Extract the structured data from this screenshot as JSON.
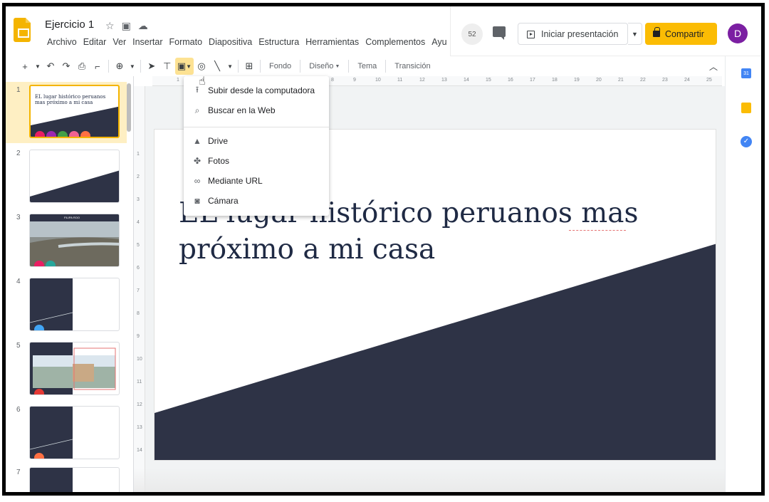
{
  "document": {
    "title": "Ejercicio 1"
  },
  "menubar": [
    "Archivo",
    "Editar",
    "Ver",
    "Insertar",
    "Formato",
    "Diapositiva",
    "Estructura",
    "Herramientas",
    "Complementos",
    "Ayu"
  ],
  "header": {
    "badge_count": "52",
    "present_label": "Iniciar presentación",
    "share_label": "Compartir",
    "avatar_initial": "D"
  },
  "toolbar": {
    "fondo": "Fondo",
    "diseno": "Diseño",
    "tema": "Tema",
    "transicion": "Transición"
  },
  "side_panel": {
    "calendar_day": "31"
  },
  "ruler": {
    "top": [
      "1",
      "2",
      "3",
      "4",
      "5",
      "6",
      "7",
      "8",
      "9",
      "10",
      "11",
      "12",
      "13",
      "14",
      "15",
      "16",
      "17",
      "18",
      "19",
      "20",
      "21",
      "22",
      "23",
      "24",
      "25"
    ],
    "left": [
      "1",
      "2",
      "3",
      "4",
      "5",
      "6",
      "7",
      "8",
      "9",
      "10",
      "11",
      "12",
      "13",
      "14"
    ]
  },
  "slides": [
    {
      "number": "1",
      "text": "EL lugar histórico peruanos mas próximo a mi casa"
    },
    {
      "number": "2"
    },
    {
      "number": "3",
      "caption": "FILIPA ROO"
    },
    {
      "number": "4"
    },
    {
      "number": "5"
    },
    {
      "number": "6"
    },
    {
      "number": "7"
    }
  ],
  "slide_main": {
    "title_line1": "EL lugar histórico peruanos mas",
    "title_line2": "próximo a mi casa"
  },
  "image_menu": {
    "items": [
      {
        "label": "Subir desde la computadora",
        "icon": "upload-icon"
      },
      {
        "label": "Buscar en la Web",
        "icon": "search-icon"
      },
      {
        "label": "Drive",
        "icon": "drive-icon"
      },
      {
        "label": "Fotos",
        "icon": "photos-icon"
      },
      {
        "label": "Mediante URL",
        "icon": "link-icon"
      },
      {
        "label": "Cámara",
        "icon": "camera-icon"
      }
    ]
  },
  "colors": {
    "accent": "#fbbc04",
    "slide_dark": "#2e3346",
    "avatar": "#7b1fa2"
  }
}
